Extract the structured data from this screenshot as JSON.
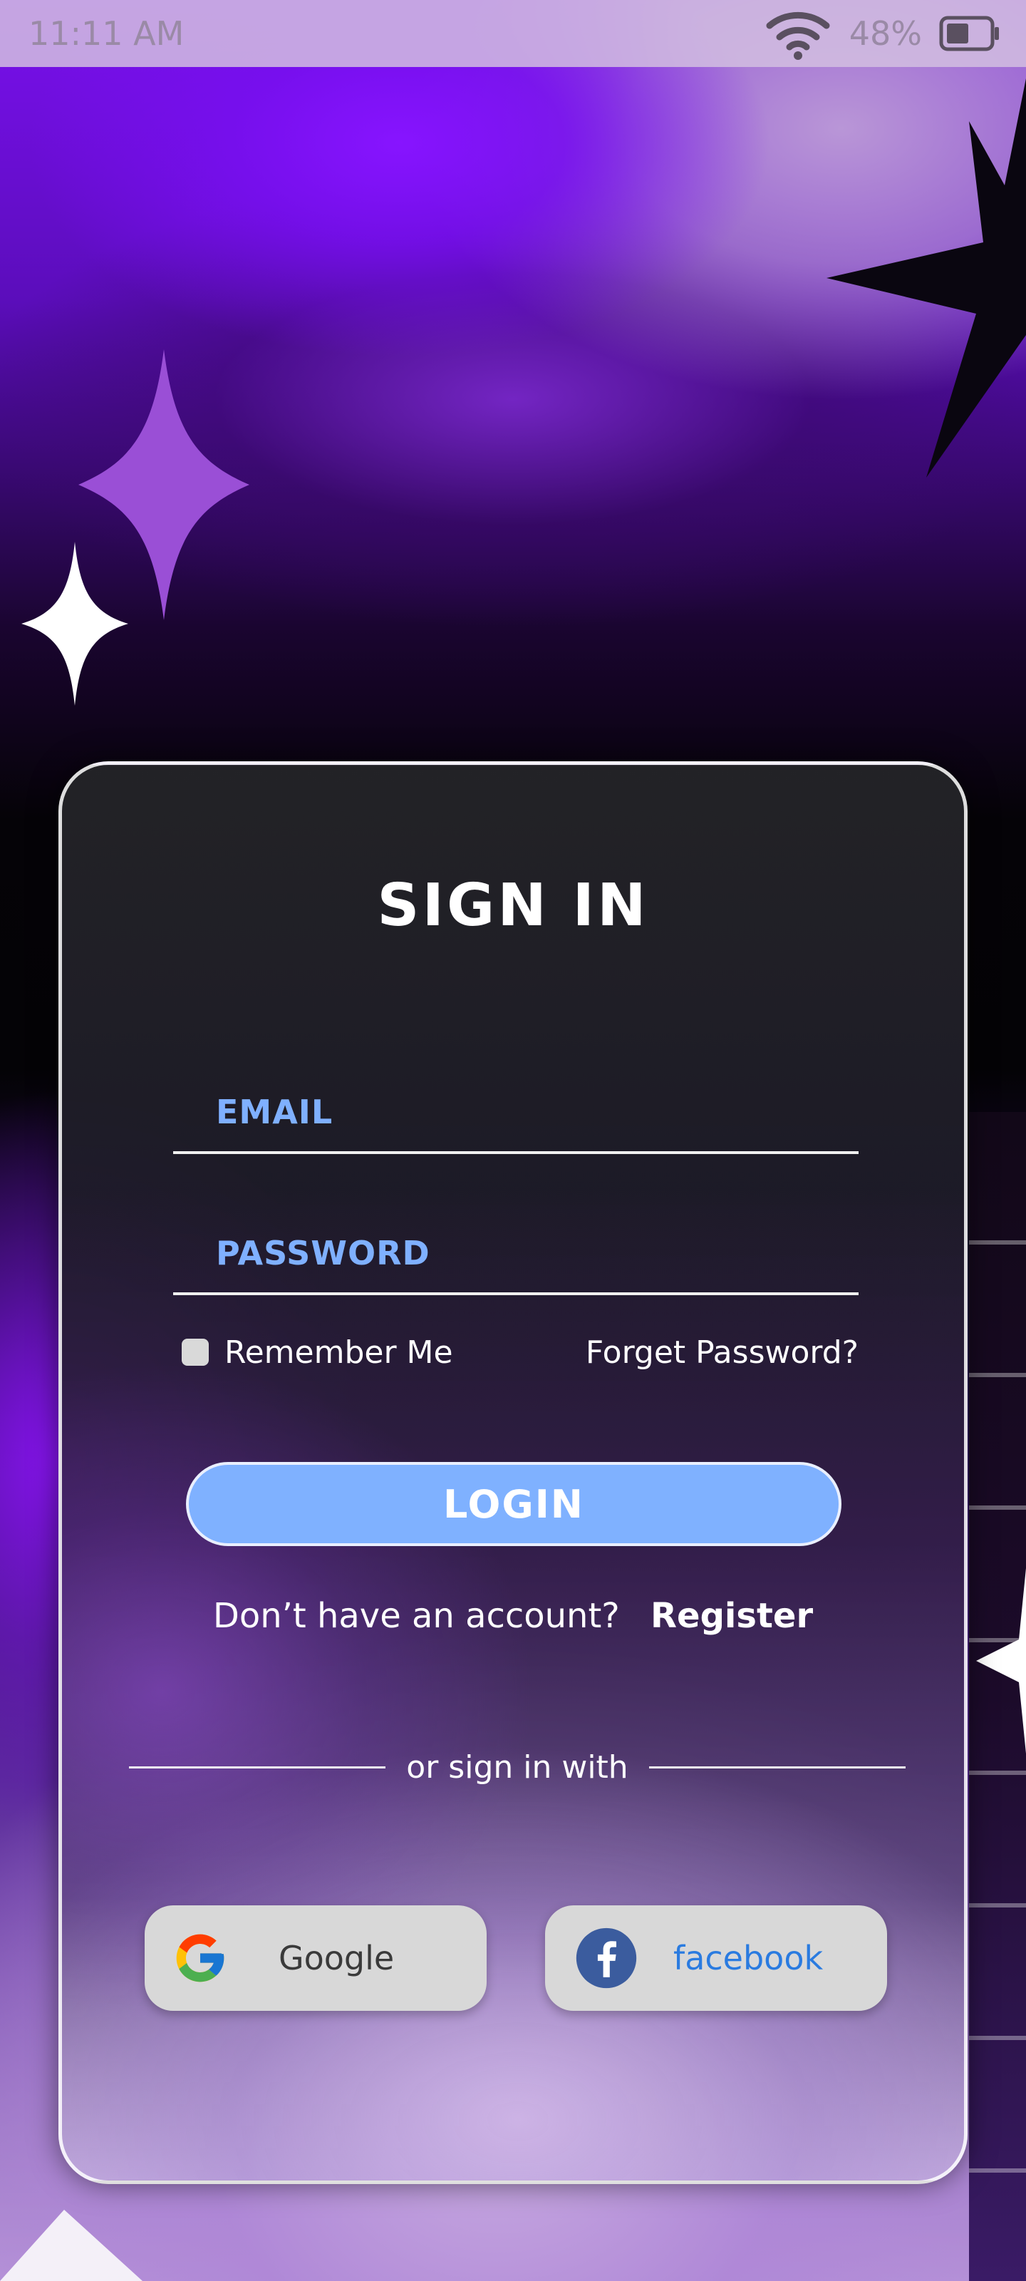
{
  "status_bar": {
    "time": "11:11 AM",
    "battery_percent": "48%",
    "wifi_icon": "wifi-icon",
    "battery_icon": "battery-icon"
  },
  "login_card": {
    "title": "SIGN IN",
    "email": {
      "placeholder": "EMAIL",
      "value": ""
    },
    "password": {
      "placeholder": "PASSWORD",
      "value": ""
    },
    "remember_me": {
      "label": "Remember Me",
      "checked": false
    },
    "forgot_password_label": "Forget Password?",
    "login_label": "LOGIN",
    "no_account_text": "Don’t have an account?",
    "register_label": "Register",
    "divider_text": "or sign in with",
    "social": {
      "google_label": "Google",
      "facebook_label": "facebook"
    }
  },
  "colors": {
    "accent": "#7fb1ff",
    "field_text": "#7fb0ff",
    "facebook_text": "#2a7be0"
  }
}
